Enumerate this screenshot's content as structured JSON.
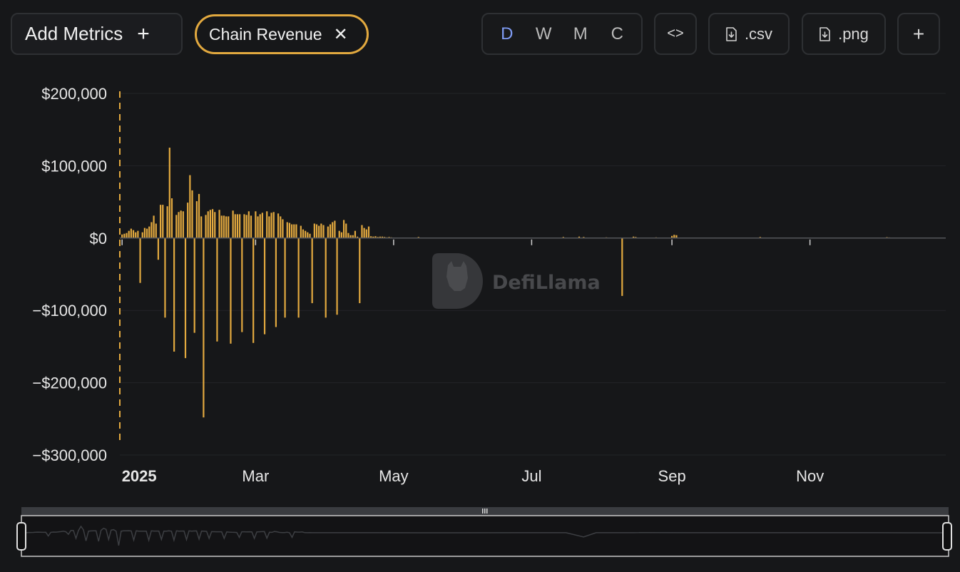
{
  "toolbar": {
    "add_metrics_label": "Add Metrics",
    "add_icon": "+",
    "metric_pill_label": "Chain Revenue",
    "remove_icon": "✕",
    "periods": [
      "D",
      "W",
      "M",
      "C"
    ],
    "active_period": "D",
    "embed_label": "<>",
    "csv_label": ".csv",
    "png_label": ".png",
    "more_label": "+"
  },
  "watermark": "DefiLlama",
  "colors": {
    "accent": "#e2a93f",
    "background": "#161719",
    "active_period": "#7f9cf5",
    "grid": "#232428",
    "brush": "#2f3134"
  },
  "chart_data": {
    "type": "bar",
    "title": "",
    "xlabel": "",
    "ylabel": "",
    "ylim": [
      -300000,
      200000
    ],
    "y_ticks": [
      200000,
      100000,
      0,
      -100000,
      -200000,
      -300000
    ],
    "y_tick_labels": [
      "$200,000",
      "$100,000",
      "$0",
      "−$100,000",
      "−$200,000",
      "−$300,000"
    ],
    "x_tick_labels": [
      "2025",
      "Mar",
      "May",
      "Jul",
      "Sep",
      "Nov"
    ],
    "x_tick_dates": [
      "2025-01-01",
      "2025-03-01",
      "2025-05-01",
      "2025-07-01",
      "2025-09-01",
      "2025-11-01"
    ],
    "x_range": [
      "2024-12-31",
      "2025-12-31"
    ],
    "grid": true,
    "series": [
      {
        "color": "#e2a93f",
        "points": [
          [
            "2025-01-01",
            5000
          ],
          [
            "2025-01-02",
            6000
          ],
          [
            "2025-01-03",
            7000
          ],
          [
            "2025-01-04",
            10000
          ],
          [
            "2025-01-05",
            13000
          ],
          [
            "2025-01-06",
            11000
          ],
          [
            "2025-01-07",
            8000
          ],
          [
            "2025-01-08",
            10000
          ],
          [
            "2025-01-09",
            -62000
          ],
          [
            "2025-01-10",
            8000
          ],
          [
            "2025-01-11",
            14000
          ],
          [
            "2025-01-12",
            13000
          ],
          [
            "2025-01-13",
            16000
          ],
          [
            "2025-01-14",
            22000
          ],
          [
            "2025-01-15",
            31000
          ],
          [
            "2025-01-16",
            20000
          ],
          [
            "2025-01-17",
            -30000
          ],
          [
            "2025-01-18",
            46000
          ],
          [
            "2025-01-19",
            46000
          ],
          [
            "2025-01-20",
            -110000
          ],
          [
            "2025-01-21",
            44000
          ],
          [
            "2025-01-22",
            125000
          ],
          [
            "2025-01-23",
            55000
          ],
          [
            "2025-01-24",
            -157000
          ],
          [
            "2025-01-25",
            32000
          ],
          [
            "2025-01-26",
            36000
          ],
          [
            "2025-01-27",
            38000
          ],
          [
            "2025-01-28",
            37000
          ],
          [
            "2025-01-29",
            -166000
          ],
          [
            "2025-01-30",
            49000
          ],
          [
            "2025-01-31",
            87000
          ],
          [
            "2025-02-01",
            66000
          ],
          [
            "2025-02-02",
            -131000
          ],
          [
            "2025-02-03",
            51000
          ],
          [
            "2025-02-04",
            61000
          ],
          [
            "2025-02-05",
            30000
          ],
          [
            "2025-02-06",
            -248000
          ],
          [
            "2025-02-07",
            32000
          ],
          [
            "2025-02-08",
            37000
          ],
          [
            "2025-02-09",
            39000
          ],
          [
            "2025-02-10",
            40000
          ],
          [
            "2025-02-11",
            36000
          ],
          [
            "2025-02-12",
            -143000
          ],
          [
            "2025-02-13",
            39000
          ],
          [
            "2025-02-14",
            31000
          ],
          [
            "2025-02-15",
            31000
          ],
          [
            "2025-02-16",
            30000
          ],
          [
            "2025-02-17",
            30000
          ],
          [
            "2025-02-18",
            -146000
          ],
          [
            "2025-02-19",
            38000
          ],
          [
            "2025-02-20",
            33000
          ],
          [
            "2025-02-21",
            33000
          ],
          [
            "2025-02-22",
            33000
          ],
          [
            "2025-02-23",
            -130000
          ],
          [
            "2025-02-24",
            33000
          ],
          [
            "2025-02-25",
            32000
          ],
          [
            "2025-02-26",
            37000
          ],
          [
            "2025-02-27",
            31000
          ],
          [
            "2025-02-28",
            -145000
          ],
          [
            "2025-03-01",
            37000
          ],
          [
            "2025-03-02",
            30000
          ],
          [
            "2025-03-03",
            33000
          ],
          [
            "2025-03-04",
            35000
          ],
          [
            "2025-03-05",
            -133000
          ],
          [
            "2025-03-06",
            37000
          ],
          [
            "2025-03-07",
            30000
          ],
          [
            "2025-03-08",
            35000
          ],
          [
            "2025-03-09",
            36000
          ],
          [
            "2025-03-10",
            -123000
          ],
          [
            "2025-03-11",
            34000
          ],
          [
            "2025-03-12",
            30000
          ],
          [
            "2025-03-13",
            26000
          ],
          [
            "2025-03-14",
            -110000
          ],
          [
            "2025-03-15",
            22000
          ],
          [
            "2025-03-16",
            21000
          ],
          [
            "2025-03-17",
            19000
          ],
          [
            "2025-03-18",
            19000
          ],
          [
            "2025-03-19",
            19000
          ],
          [
            "2025-03-20",
            -110000
          ],
          [
            "2025-03-21",
            17000
          ],
          [
            "2025-03-22",
            12000
          ],
          [
            "2025-03-23",
            10000
          ],
          [
            "2025-03-24",
            8000
          ],
          [
            "2025-03-25",
            6000
          ],
          [
            "2025-03-26",
            -90000
          ],
          [
            "2025-03-27",
            20000
          ],
          [
            "2025-03-28",
            19000
          ],
          [
            "2025-03-29",
            17000
          ],
          [
            "2025-03-30",
            20000
          ],
          [
            "2025-03-31",
            18000
          ],
          [
            "2025-04-01",
            -110000
          ],
          [
            "2025-04-02",
            16000
          ],
          [
            "2025-04-03",
            19000
          ],
          [
            "2025-04-04",
            22000
          ],
          [
            "2025-04-05",
            24000
          ],
          [
            "2025-04-06",
            -106000
          ],
          [
            "2025-04-07",
            10000
          ],
          [
            "2025-04-08",
            8000
          ],
          [
            "2025-04-09",
            25000
          ],
          [
            "2025-04-10",
            20000
          ],
          [
            "2025-04-11",
            7000
          ],
          [
            "2025-04-12",
            4000
          ],
          [
            "2025-04-13",
            4000
          ],
          [
            "2025-04-14",
            10000
          ],
          [
            "2025-04-15",
            2000
          ],
          [
            "2025-04-16",
            -90000
          ],
          [
            "2025-04-17",
            18000
          ],
          [
            "2025-04-18",
            14000
          ],
          [
            "2025-04-19",
            12000
          ],
          [
            "2025-04-20",
            16000
          ],
          [
            "2025-04-21",
            2500
          ],
          [
            "2025-04-22",
            2000
          ],
          [
            "2025-04-23",
            2500
          ],
          [
            "2025-04-24",
            1500
          ],
          [
            "2025-04-25",
            2000
          ],
          [
            "2025-04-26",
            2000
          ],
          [
            "2025-04-27",
            1500
          ],
          [
            "2025-04-28",
            1000
          ],
          [
            "2025-04-29",
            1500
          ],
          [
            "2025-04-30",
            1000
          ],
          [
            "2025-05-05",
            800
          ],
          [
            "2025-05-12",
            1500
          ],
          [
            "2025-05-20",
            700
          ],
          [
            "2025-06-05",
            600
          ],
          [
            "2025-06-20",
            500
          ],
          [
            "2025-07-15",
            1500
          ],
          [
            "2025-07-22",
            2000
          ],
          [
            "2025-07-24",
            1500
          ],
          [
            "2025-08-03",
            1000
          ],
          [
            "2025-08-10",
            -80000
          ],
          [
            "2025-08-15",
            2000
          ],
          [
            "2025-08-16",
            1500
          ],
          [
            "2025-08-25",
            1000
          ],
          [
            "2025-09-01",
            3000
          ],
          [
            "2025-09-02",
            4500
          ],
          [
            "2025-09-03",
            4000
          ],
          [
            "2025-09-20",
            800
          ],
          [
            "2025-10-10",
            1500
          ],
          [
            "2025-11-10",
            700
          ],
          [
            "2025-12-01",
            800
          ],
          [
            "2025-12-05",
            1200
          ],
          [
            "2025-12-06",
            900
          ]
        ]
      }
    ]
  }
}
